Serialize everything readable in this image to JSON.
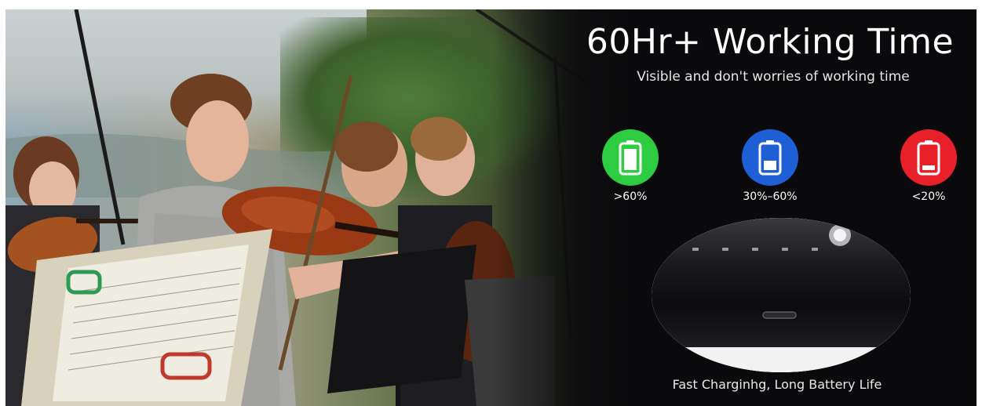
{
  "hero": {
    "title": "60Hr+ Working Time",
    "subtitle": "Visible and don't worries of working time"
  },
  "battery_levels": [
    {
      "label": ">60%",
      "color": "#2ecc40",
      "fill_fraction": 0.85,
      "icon": "battery-full-icon"
    },
    {
      "label": "30%–60%",
      "color": "#1e5fd6",
      "fill_fraction": 0.45,
      "icon": "battery-half-icon"
    },
    {
      "label": "<20%",
      "color": "#e8202a",
      "fill_fraction": 0.2,
      "icon": "battery-low-icon"
    }
  ],
  "device": {
    "caption": "Fast Charginhg, Long Battery Life",
    "port_icon": "usb-c-port-icon"
  },
  "colors": {
    "background_dark": "#0a0a0c",
    "text": "#ffffff"
  }
}
